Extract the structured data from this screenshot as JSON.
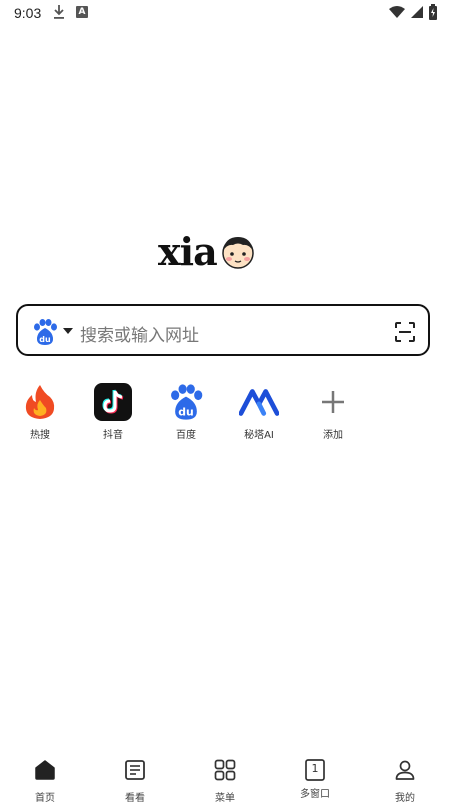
{
  "status_bar": {
    "time": "9:03",
    "icons": [
      "download-icon",
      "a-notification-icon",
      "wifi-icon",
      "signal-icon",
      "battery-icon"
    ]
  },
  "logo": {
    "text": "xia",
    "mascot": "boy-face-icon"
  },
  "search": {
    "engine_icon": "baidu-paw-icon",
    "placeholder": "搜索或输入网址",
    "scan_icon": "scan-icon"
  },
  "shortcuts": [
    {
      "label": "热搜",
      "icon": "fire-icon"
    },
    {
      "label": "抖音",
      "icon": "douyin-icon"
    },
    {
      "label": "百度",
      "icon": "baidu-paw-icon"
    },
    {
      "label": "秘塔AI",
      "icon": "metaso-icon"
    },
    {
      "label": "添加",
      "icon": "plus-icon"
    }
  ],
  "bottom_nav": [
    {
      "label": "首页",
      "icon": "home-icon",
      "active": true
    },
    {
      "label": "看看",
      "icon": "article-icon"
    },
    {
      "label": "菜单",
      "icon": "grid-icon"
    },
    {
      "label": "多窗口",
      "icon": "windows-icon",
      "count": "1"
    },
    {
      "label": "我的",
      "icon": "user-icon"
    }
  ],
  "colors": {
    "baidu_blue": "#2d6ae8",
    "fire_red": "#f04b23",
    "metaso_blue": "#1d4ed8",
    "text_dark": "#222222",
    "placeholder_gray": "#777777"
  }
}
